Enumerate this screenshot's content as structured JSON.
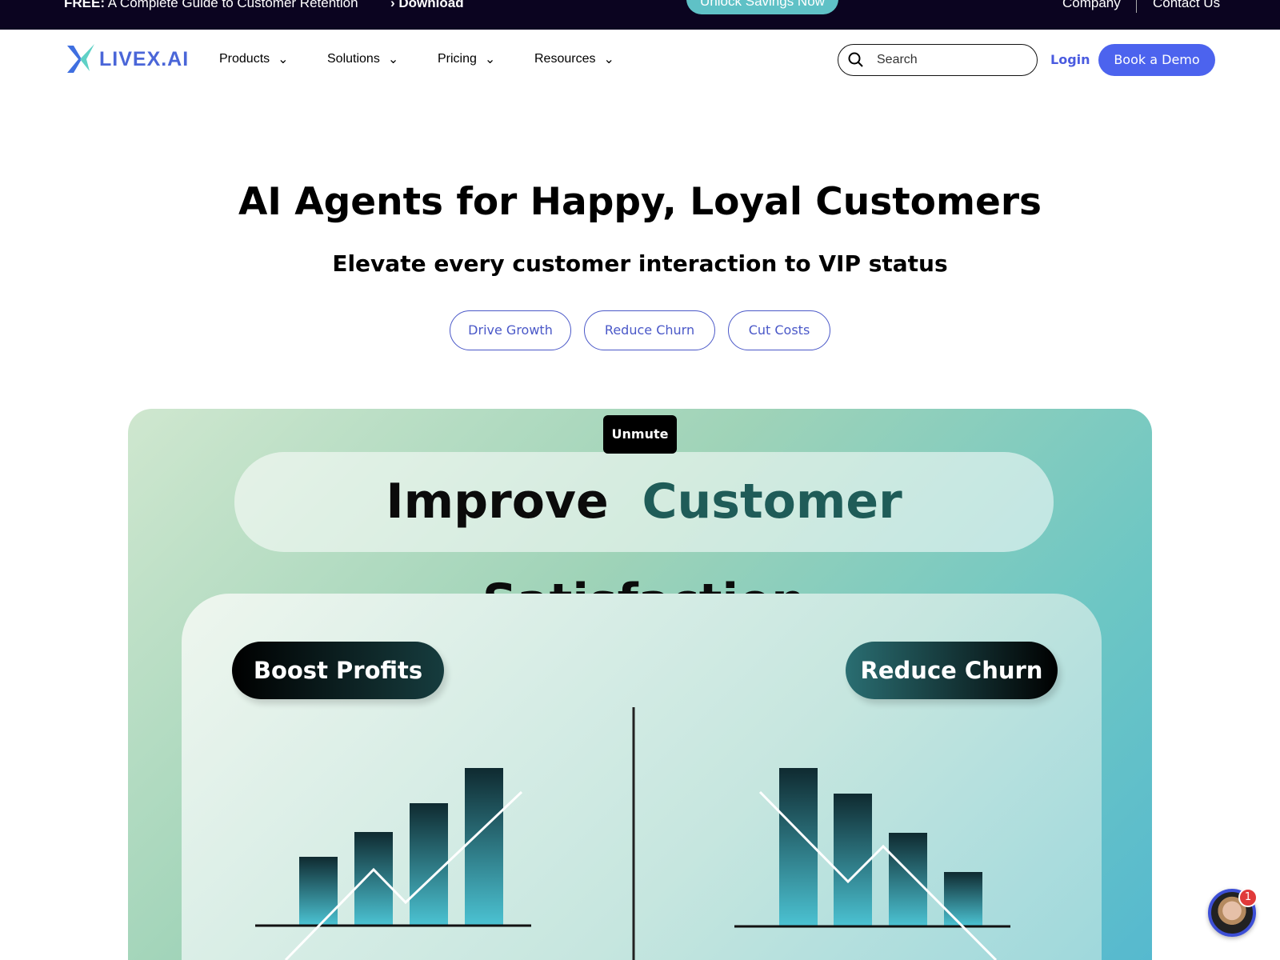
{
  "topbar": {
    "promo_bold": "FREE:",
    "promo_text": "A Complete Guide to Customer Retention",
    "download": "Download",
    "unlock": "Unlock Savings Now",
    "company": "Company",
    "contact": "Contact Us"
  },
  "nav": {
    "logo": "LIVEX.AI",
    "items": [
      {
        "label": "Products"
      },
      {
        "label": "Solutions"
      },
      {
        "label": "Pricing"
      },
      {
        "label": "Resources"
      }
    ],
    "search_placeholder": "Search",
    "login": "Login",
    "demo": "Book a Demo"
  },
  "hero": {
    "title": "AI Agents for Happy, Loyal Customers",
    "subtitle": "Elevate every customer interaction to VIP status",
    "pills": [
      "Drive Growth",
      "Reduce Churn",
      "Cut Costs"
    ]
  },
  "video": {
    "unmute": "Unmute",
    "headline_a": "Improve",
    "headline_b": "Customer",
    "headline_c": "Satisfaction",
    "left_label": "Boost Profits",
    "right_label": "Reduce Churn"
  },
  "chat": {
    "badge": "1"
  },
  "colors": {
    "accent": "#4c63ee",
    "topbar": "#0b0420",
    "teal": "#5fc1c6"
  }
}
